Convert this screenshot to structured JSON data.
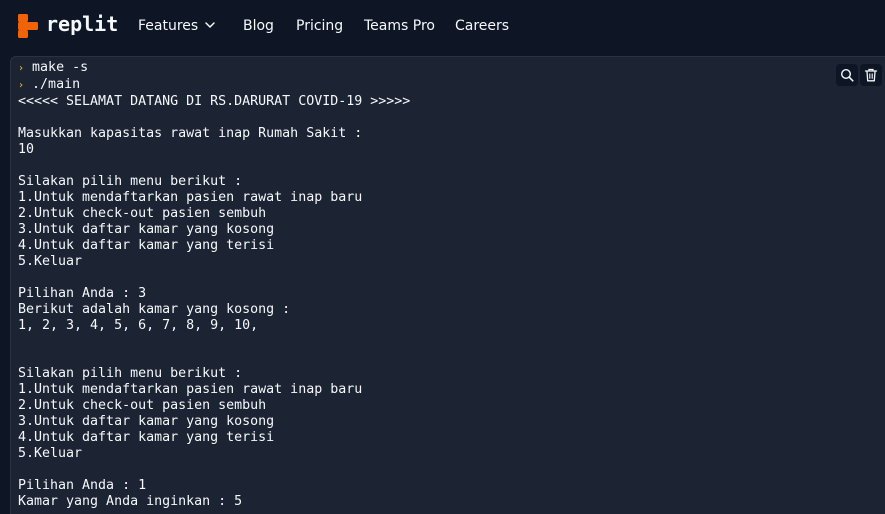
{
  "header": {
    "brand": "replit",
    "nav": [
      "Features",
      "Blog",
      "Pricing",
      "Teams Pro",
      "Careers"
    ],
    "colors": {
      "background": "#0e1525",
      "logo": "#f26207",
      "text": "#f5f9fc"
    }
  },
  "console": {
    "commands": [
      "make -s",
      "./main"
    ],
    "output": "<<<<< SELAMAT DATANG DI RS.DARURAT COVID-19 >>>>>\n\nMasukkan kapasitas rawat inap Rumah Sakit :\n10\n\nSilakan pilih menu berikut :\n1.Untuk mendaftarkan pasien rawat inap baru\n2.Untuk check-out pasien sembuh\n3.Untuk daftar kamar yang kosong\n4.Untuk daftar kamar yang terisi\n5.Keluar\n\nPilihan Anda : 3\nBerikut adalah kamar yang kosong :\n1, 2, 3, 4, 5, 6, 7, 8, 9, 10,\n\n\nSilakan pilih menu berikut :\n1.Untuk mendaftarkan pasien rawat inap baru\n2.Untuk check-out pasien sembuh\n3.Untuk daftar kamar yang kosong\n4.Untuk daftar kamar yang terisi\n5.Keluar\n\nPilihan Anda : 1\nKamar yang Anda inginkan : 5",
    "colors": {
      "background": "#1c2333",
      "prompt": "#ffbc24",
      "text": "#f5f9fc"
    },
    "tools": [
      "search-icon",
      "trash-icon"
    ]
  }
}
